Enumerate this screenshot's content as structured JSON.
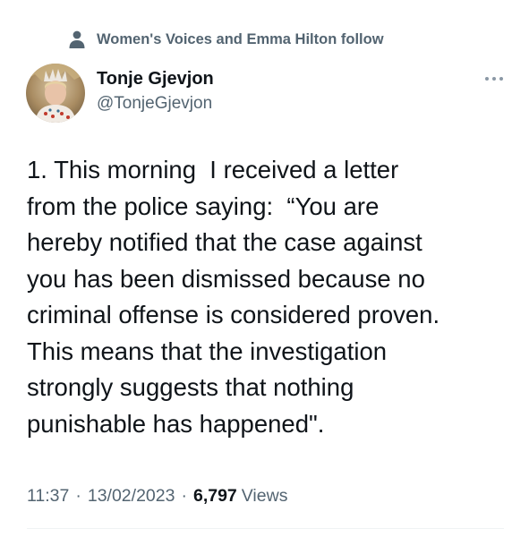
{
  "social_context": {
    "text": "Women's Voices and Emma Hilton follow",
    "icon": "person-icon"
  },
  "author": {
    "display_name": "Tonje Gjevjon",
    "handle": "@TonjeGjevjon"
  },
  "tweet": {
    "lines": [
      "1. This morning  I received a letter",
      "from the police saying:  “You are",
      "hereby notified that the case against",
      "you has been dismissed because no",
      "criminal offense is considered proven.",
      "This means that the investigation",
      "strongly suggests that nothing",
      "punishable has happened\"."
    ]
  },
  "meta": {
    "time": "11:37",
    "separator": "·",
    "date": "13/02/2023",
    "views_count": "6,797",
    "views_label": "Views"
  },
  "colors": {
    "primary_text": "#0f1419",
    "secondary_text": "#536471",
    "divider": "#eff3f4"
  }
}
